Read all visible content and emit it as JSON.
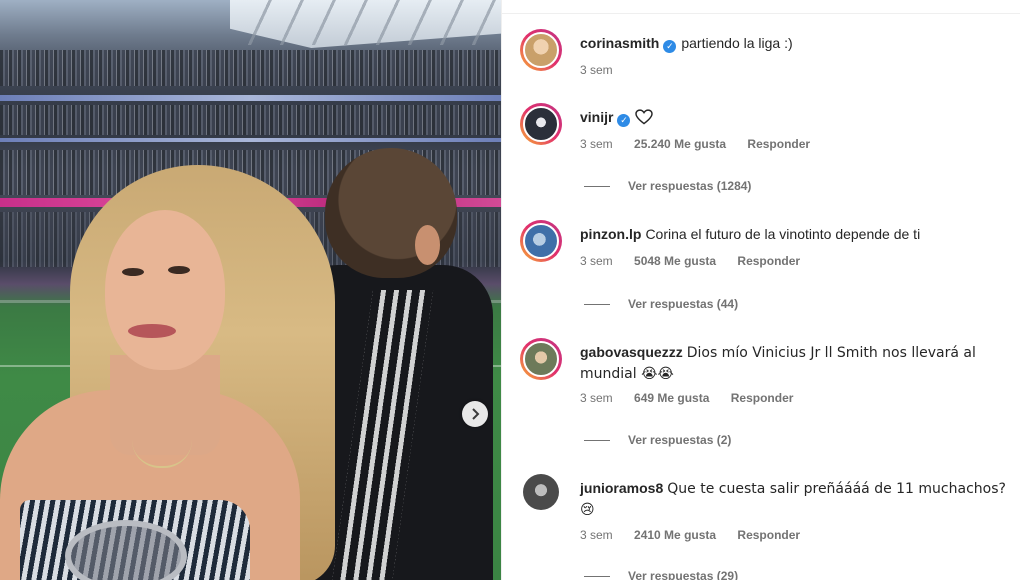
{
  "comments": [
    {
      "username": "corinasmith",
      "verified": true,
      "text": "partiendo la liga :)",
      "time": "3 sem",
      "avatar_color": "#c9a06a"
    },
    {
      "username": "vinijr",
      "verified": true,
      "text": "",
      "has_heart": true,
      "time": "3 sem",
      "likes": "25.240 Me gusta",
      "reply": "Responder",
      "view_replies": "Ver respuestas (1284)",
      "avatar_color": "#2b2f3a"
    },
    {
      "username": "pinzon.lp",
      "verified": false,
      "text": "Corina el futuro de la vinotinto depende de ti",
      "time": "3 sem",
      "likes": "5048 Me gusta",
      "reply": "Responder",
      "view_replies": "Ver respuestas (44)",
      "avatar_color": "#3f6fa8"
    },
    {
      "username": "gabovasquezzz",
      "verified": false,
      "text": "Dios mío Vinicius Jr ll Smith nos llevará al mundial 😭😭",
      "time": "3 sem",
      "likes": "649 Me gusta",
      "reply": "Responder",
      "view_replies": "Ver respuestas (2)",
      "avatar_color": "#6d7a5a"
    },
    {
      "username": "junioramos8",
      "verified": false,
      "text": "Que te cuesta salir preñáááá de 11 muchachos? 😢",
      "time": "3 sem",
      "likes": "2410 Me gusta",
      "reply": "Responder",
      "view_replies": "Ver respuestas (29)",
      "avatar_color": "#4a4a4a"
    }
  ],
  "colors": {
    "verified": "#2e8be6",
    "meta_text": "#737373",
    "story_ring": "#e1306c"
  },
  "icons": {
    "heart": "heart-icon",
    "verified": "verified-badge-icon",
    "next": "chevron-right-icon"
  }
}
